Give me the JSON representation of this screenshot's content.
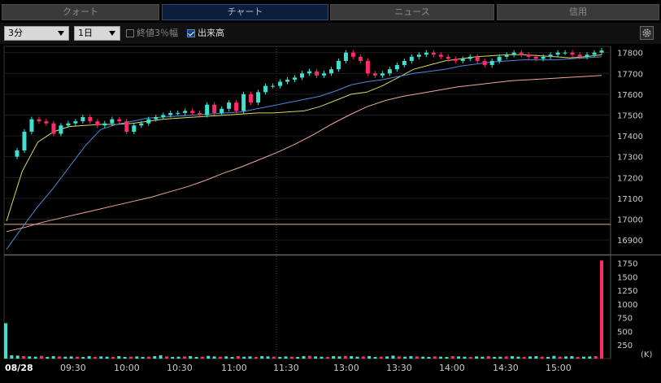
{
  "tabs": [
    {
      "label": "クォート",
      "active": false
    },
    {
      "label": "チャート",
      "active": true
    },
    {
      "label": "ニュース",
      "active": false
    },
    {
      "label": "信用",
      "active": false
    }
  ],
  "toolbar": {
    "interval": "3分",
    "period": "1日",
    "close_pct_label": "終値3％幅",
    "close_pct_checked": false,
    "volume_label": "出来高",
    "volume_checked": true,
    "settings_icon": "gear-icon"
  },
  "chart_data": [
    {
      "type": "candlestick",
      "title": "",
      "price_axis_ticks": [
        17800,
        17700,
        17600,
        17500,
        17400,
        17300,
        17200,
        17100,
        17000,
        16900
      ],
      "ylim": [
        16830,
        17830
      ],
      "time_axis_labels": [
        "08/28",
        "09:30",
        "10:00",
        "10:30",
        "11:00",
        "11:30",
        "13:00",
        "13:30",
        "14:00",
        "14:30",
        "15:00"
      ],
      "reference_line": 16975,
      "series": [
        {
          "name": "short MA",
          "color": "#d8d860",
          "values": [
            16990,
            17230,
            17370,
            17420,
            17445,
            17450,
            17455,
            17455,
            17460,
            17470,
            17480,
            17485,
            17490,
            17495,
            17500,
            17505,
            17510,
            17510,
            17515,
            17520,
            17540,
            17570,
            17600,
            17610,
            17640,
            17680,
            17720,
            17740,
            17760,
            17770,
            17780,
            17785,
            17790,
            17790,
            17785,
            17780,
            17775,
            17780,
            17790
          ]
        },
        {
          "name": "medium MA",
          "color": "#4a8ad8",
          "values": [
            16855,
            16960,
            17060,
            17150,
            17250,
            17350,
            17430,
            17455,
            17470,
            17485,
            17490,
            17495,
            17500,
            17505,
            17510,
            17515,
            17530,
            17545,
            17560,
            17575,
            17590,
            17615,
            17645,
            17660,
            17670,
            17685,
            17700,
            17710,
            17720,
            17735,
            17745,
            17755,
            17760,
            17765,
            17765,
            17765,
            17770,
            17775,
            17780
          ]
        },
        {
          "name": "long MA",
          "color": "#f0a898",
          "values": [
            16940,
            16960,
            16985,
            17005,
            17025,
            17045,
            17065,
            17085,
            17105,
            17130,
            17155,
            17185,
            17220,
            17250,
            17285,
            17320,
            17360,
            17405,
            17455,
            17500,
            17540,
            17570,
            17590,
            17605,
            17620,
            17635,
            17645,
            17655,
            17665,
            17670,
            17675,
            17680,
            17685,
            17690
          ]
        },
        {
          "name": "candles",
          "bull_color": "#40e0d0",
          "bear_color": "#ff2a6a",
          "values": [
            17300,
            17330,
            17420,
            17480,
            17470,
            17460,
            17410,
            17450,
            17460,
            17470,
            17490,
            17470,
            17450,
            17460,
            17480,
            17470,
            17420,
            17450,
            17460,
            17480,
            17490,
            17500,
            17510,
            17510,
            17520,
            17510,
            17500,
            17550,
            17510,
            17530,
            17560,
            17520,
            17600,
            17560,
            17610,
            17640,
            17640,
            17660,
            17670,
            17680,
            17700,
            17710,
            17690,
            17700,
            17720,
            17760,
            17800,
            17780,
            17760,
            17700,
            17690,
            17700,
            17720,
            17740,
            17760,
            17780,
            17790,
            17800,
            17790,
            17780,
            17770,
            17760,
            17770,
            17780,
            17760,
            17740,
            17760,
            17780,
            17790,
            17800,
            17790,
            17780,
            17770,
            17780,
            17790,
            17800,
            17800,
            17790,
            17780,
            17790,
            17800,
            17810
          ]
        }
      ]
    },
    {
      "type": "bar",
      "title": "出来高",
      "unit_label": "(K)",
      "ylim": [
        0,
        1850
      ],
      "y_ticks": [
        1750,
        1500,
        1250,
        1000,
        750,
        500,
        250
      ],
      "values": [
        650,
        60,
        55,
        45,
        40,
        35,
        50,
        30,
        45,
        40,
        35,
        40,
        35,
        30,
        45,
        30,
        40,
        35,
        30,
        45,
        30,
        35,
        40,
        30,
        35,
        45,
        60,
        40,
        30,
        35,
        40,
        45,
        30,
        35,
        50,
        40,
        35,
        40,
        30,
        45,
        35,
        40,
        30,
        45,
        40,
        35,
        30,
        40,
        35,
        30,
        45,
        50,
        40,
        35,
        30,
        45,
        40,
        50,
        45,
        35,
        40,
        45,
        30,
        35,
        40,
        55,
        40,
        35,
        45,
        40,
        35,
        30,
        40,
        35,
        30,
        45,
        40,
        35,
        30,
        40,
        35,
        45,
        30,
        35,
        40,
        45,
        35,
        30,
        40,
        45,
        35,
        30,
        50,
        35,
        40,
        45,
        30,
        35,
        40,
        45,
        1800
      ],
      "colors_note": "mixed"
    }
  ]
}
